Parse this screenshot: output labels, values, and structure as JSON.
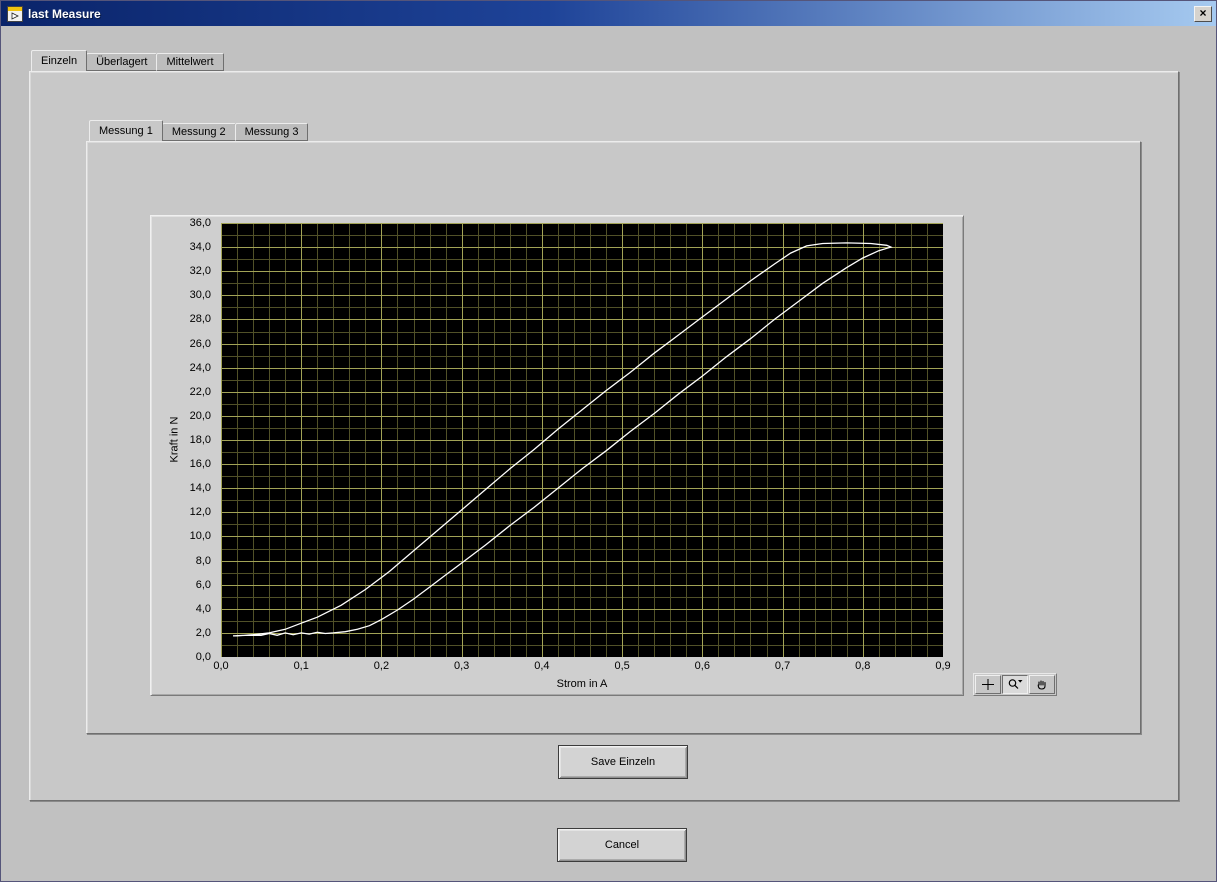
{
  "window": {
    "title": "last Measure",
    "close_glyph": "×"
  },
  "tabs": {
    "outer": {
      "selected": "Einzeln",
      "items": [
        {
          "label": "Einzeln"
        },
        {
          "label": "Überlagert"
        },
        {
          "label": "Mittelwert"
        }
      ]
    },
    "inner": {
      "selected": "Messung 1",
      "items": [
        {
          "label": "Messung 1"
        },
        {
          "label": "Messung 2"
        },
        {
          "label": "Messung 3"
        }
      ]
    }
  },
  "buttons": {
    "save_label": "Save Einzeln",
    "cancel_label": "Cancel"
  },
  "graph_palette": {
    "tools": [
      {
        "name": "crosshair"
      },
      {
        "name": "zoom"
      },
      {
        "name": "pan"
      }
    ],
    "active_tool": "zoom"
  },
  "chart_data": {
    "type": "line",
    "title": "",
    "xlabel": "Strom in A",
    "ylabel": "Kraft in N",
    "xlim": [
      0,
      0.9
    ],
    "ylim": [
      0,
      36
    ],
    "grid": {
      "background": "#000000",
      "major_color": "#a2a356",
      "minor_color": "#515128",
      "x_minor_step": 0.02,
      "y_minor_step": 1
    },
    "xticks": [
      0,
      0.1,
      0.2,
      0.3,
      0.4,
      0.5,
      0.6,
      0.7,
      0.8,
      0.9
    ],
    "xtick_labels": [
      "0,0",
      "0,1",
      "0,2",
      "0,3",
      "0,4",
      "0,5",
      "0,6",
      "0,7",
      "0,8",
      "0,9"
    ],
    "yticks": [
      0,
      2,
      4,
      6,
      8,
      10,
      12,
      14,
      16,
      18,
      20,
      22,
      24,
      26,
      28,
      30,
      32,
      34,
      36
    ],
    "ytick_labels": [
      "0,0",
      "2,0",
      "4,0",
      "6,0",
      "8,0",
      "10,0",
      "12,0",
      "14,0",
      "16,0",
      "18,0",
      "20,0",
      "22,0",
      "24,0",
      "26,0",
      "28,0",
      "30,0",
      "32,0",
      "34,0",
      "36,0"
    ],
    "series": [
      {
        "name": "Messung 1",
        "color": "#ffffff",
        "points": [
          [
            0.015,
            1.75
          ],
          [
            0.03,
            1.8
          ],
          [
            0.05,
            1.8
          ],
          [
            0.06,
            1.95
          ],
          [
            0.07,
            1.8
          ],
          [
            0.08,
            2.0
          ],
          [
            0.09,
            1.85
          ],
          [
            0.1,
            2.0
          ],
          [
            0.11,
            1.9
          ],
          [
            0.12,
            2.05
          ],
          [
            0.13,
            1.95
          ],
          [
            0.14,
            2.0
          ],
          [
            0.155,
            2.1
          ],
          [
            0.17,
            2.3
          ],
          [
            0.185,
            2.6
          ],
          [
            0.2,
            3.1
          ],
          [
            0.22,
            3.9
          ],
          [
            0.24,
            4.8
          ],
          [
            0.26,
            5.8
          ],
          [
            0.28,
            6.8
          ],
          [
            0.3,
            7.8
          ],
          [
            0.33,
            9.3
          ],
          [
            0.36,
            10.9
          ],
          [
            0.39,
            12.4
          ],
          [
            0.42,
            14.0
          ],
          [
            0.45,
            15.6
          ],
          [
            0.48,
            17.1
          ],
          [
            0.51,
            18.7
          ],
          [
            0.54,
            20.2
          ],
          [
            0.57,
            21.8
          ],
          [
            0.6,
            23.3
          ],
          [
            0.63,
            24.9
          ],
          [
            0.66,
            26.4
          ],
          [
            0.69,
            28.0
          ],
          [
            0.72,
            29.5
          ],
          [
            0.75,
            31.0
          ],
          [
            0.78,
            32.3
          ],
          [
            0.8,
            33.1
          ],
          [
            0.82,
            33.7
          ],
          [
            0.835,
            34.0
          ],
          [
            0.83,
            34.15
          ],
          [
            0.81,
            34.3
          ],
          [
            0.78,
            34.35
          ],
          [
            0.75,
            34.3
          ],
          [
            0.73,
            34.1
          ],
          [
            0.71,
            33.5
          ],
          [
            0.69,
            32.6
          ],
          [
            0.66,
            31.2
          ],
          [
            0.63,
            29.7
          ],
          [
            0.6,
            28.2
          ],
          [
            0.57,
            26.7
          ],
          [
            0.54,
            25.2
          ],
          [
            0.51,
            23.6
          ],
          [
            0.48,
            22.1
          ],
          [
            0.45,
            20.5
          ],
          [
            0.42,
            18.9
          ],
          [
            0.39,
            17.2
          ],
          [
            0.36,
            15.6
          ],
          [
            0.33,
            13.9
          ],
          [
            0.3,
            12.2
          ],
          [
            0.27,
            10.5
          ],
          [
            0.24,
            8.8
          ],
          [
            0.21,
            7.1
          ],
          [
            0.18,
            5.6
          ],
          [
            0.15,
            4.3
          ],
          [
            0.12,
            3.3
          ],
          [
            0.1,
            2.8
          ],
          [
            0.08,
            2.3
          ],
          [
            0.06,
            2.0
          ],
          [
            0.04,
            1.85
          ],
          [
            0.02,
            1.75
          ]
        ]
      }
    ]
  }
}
